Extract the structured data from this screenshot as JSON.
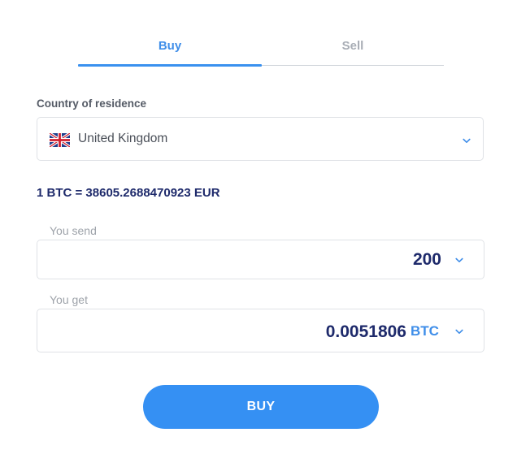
{
  "tabs": {
    "buy_label": "Buy",
    "sell_label": "Sell",
    "active": "Buy"
  },
  "country": {
    "label": "Country of residence",
    "selected": "United Kingdom",
    "flag_icon": "uk-flag-icon"
  },
  "rate": {
    "text": "1 BTC = 38605.2688470923 EUR"
  },
  "send": {
    "label": "You send",
    "value": "200",
    "currency": ""
  },
  "get": {
    "label": "You get",
    "value": "0.0051806",
    "currency": "BTC"
  },
  "action": {
    "buy_label": "BUY"
  },
  "colors": {
    "accent": "#3590f3",
    "tab_active": "#3f8ee9",
    "tab_inactive": "#a8adb5",
    "value_text": "#1e2a6b",
    "border": "#dfe2e6"
  }
}
